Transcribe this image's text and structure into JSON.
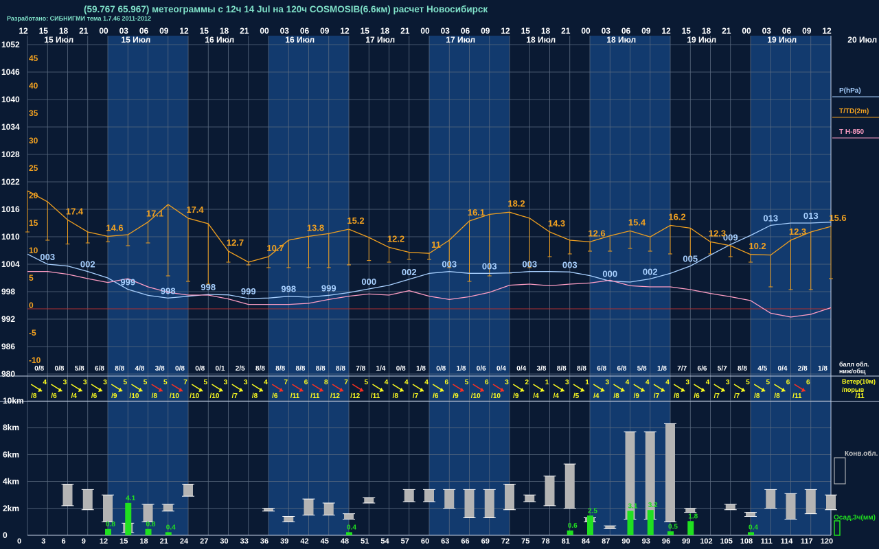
{
  "header": {
    "title": "(59.767 65.967) метеограммы с  12ч 14 Jul на 120ч COSMOSIB(6.6км) расчет Новосибирск",
    "credit": "Разработано: СИБНИГМИ тема 1.7.46 2011-2012"
  },
  "colors": {
    "background": "#0a1a33",
    "band": "#123a6e",
    "grid": "#5a6a80",
    "pressure": "#a8d0ff",
    "temperature": "#f0a020",
    "t850": "#ff9ec4",
    "wind_yellow": "#ffff20",
    "wind_red": "#ff3020",
    "cloud": "#b4b4b4",
    "precip": "#20e020",
    "zero_line": "#b03030"
  },
  "chart_data": [
    {
      "type": "line",
      "name": "meteogram",
      "x_hours": [
        0,
        3,
        6,
        9,
        12,
        15,
        18,
        21,
        24,
        27,
        30,
        33,
        36,
        39,
        42,
        45,
        48,
        51,
        54,
        57,
        60,
        63,
        66,
        69,
        72,
        75,
        78,
        81,
        84,
        87,
        90,
        93,
        96,
        99,
        102,
        105,
        108,
        111,
        114,
        117,
        120
      ],
      "top_hour_labels": [
        "12",
        "15",
        "18",
        "21",
        "00",
        "03",
        "06",
        "09",
        "12",
        "15",
        "18",
        "21",
        "00",
        "03",
        "06",
        "09",
        "12",
        "15",
        "18",
        "21",
        "00",
        "03",
        "06",
        "09",
        "12",
        "15",
        "18",
        "21",
        "00",
        "03",
        "06",
        "09",
        "12",
        "15",
        "18",
        "21",
        "00",
        "03",
        "06",
        "09",
        "12"
      ],
      "day_labels": [
        {
          "hour": 1,
          "text": "15 Июл"
        },
        {
          "hour": 12.5,
          "text": "15 Июл"
        },
        {
          "hour": 25,
          "text": "16 Июл"
        },
        {
          "hour": 37,
          "text": "16 Июл"
        },
        {
          "hour": 49,
          "text": "17 Июл"
        },
        {
          "hour": 61,
          "text": "17 Июл"
        },
        {
          "hour": 73,
          "text": "18 Июл"
        },
        {
          "hour": 85,
          "text": "18 Июл"
        },
        {
          "hour": 97,
          "text": "19 Июл"
        },
        {
          "hour": 109,
          "text": "19 Июл"
        },
        {
          "hour": 121,
          "text": "20 Июл"
        }
      ],
      "pressure_axis": {
        "label": "P(hPa)",
        "ticks": [
          1052,
          1046,
          1040,
          1034,
          1028,
          1022,
          1016,
          1010,
          1004,
          998,
          992,
          986,
          980
        ],
        "ylim": [
          980,
          1054
        ]
      },
      "temperature_axis": {
        "label": "T/TD(2m)",
        "ticks": [
          45,
          40,
          35,
          30,
          25,
          20,
          15,
          10,
          5,
          0,
          -5,
          -10
        ],
        "ylim": [
          -13,
          49
        ]
      },
      "t850_label": "T H-850",
      "pressure": {
        "values": [
          1006.2,
          1004.0,
          1003.6,
          1002.4,
          1001.0,
          998.5,
          997.2,
          996.6,
          997.0,
          997.4,
          997.3,
          996.5,
          996.6,
          997.0,
          996.8,
          997.2,
          997.8,
          998.6,
          999.4,
          1000.7,
          1002.0,
          1002.4,
          1002.0,
          1002.0,
          1002.1,
          1002.4,
          1002.4,
          1002.3,
          1001.5,
          1000.3,
          1000.1,
          1000.8,
          1002.0,
          1003.6,
          1006.0,
          1008.3,
          1010.3,
          1012.5,
          1013.0,
          1013.0,
          1013.2
        ],
        "labels": [
          {
            "i": 1,
            "text": "003"
          },
          {
            "i": 3,
            "text": "002"
          },
          {
            "i": 5,
            "text": "999"
          },
          {
            "i": 7,
            "text": "998"
          },
          {
            "i": 9,
            "text": "998"
          },
          {
            "i": 11,
            "text": "999"
          },
          {
            "i": 13,
            "text": "998"
          },
          {
            "i": 15,
            "text": "999"
          },
          {
            "i": 17,
            "text": "000"
          },
          {
            "i": 19,
            "text": "002"
          },
          {
            "i": 21,
            "text": "003"
          },
          {
            "i": 23,
            "text": "003"
          },
          {
            "i": 25,
            "text": "003"
          },
          {
            "i": 27,
            "text": "003"
          },
          {
            "i": 29,
            "text": "000"
          },
          {
            "i": 31,
            "text": "002"
          },
          {
            "i": 33,
            "text": "005"
          },
          {
            "i": 35,
            "text": "009"
          },
          {
            "i": 37,
            "text": "013"
          },
          {
            "i": 39,
            "text": "013"
          }
        ]
      },
      "temperature": {
        "values": [
          21.5,
          19.5,
          16.2,
          14.0,
          13.2,
          13.5,
          15.8,
          19.0,
          16.5,
          15.5,
          10.5,
          8.5,
          9.5,
          12.5,
          13.2,
          13.7,
          14.5,
          13.0,
          11.2,
          10.3,
          10.1,
          12.5,
          16.0,
          17.2,
          17.6,
          16.5,
          14.0,
          12.5,
          12.2,
          13.3,
          14.2,
          13.1,
          15.2,
          14.7,
          12.2,
          11.5,
          9.9,
          9.8,
          12.5,
          14.0,
          15.0
        ],
        "labels": [
          {
            "i": 2,
            "text": "17.4"
          },
          {
            "i": 4,
            "text": "14.6"
          },
          {
            "i": 6,
            "text": "17.1"
          },
          {
            "i": 8,
            "text": "17.4"
          },
          {
            "i": 10,
            "text": "12.7"
          },
          {
            "i": 12,
            "text": "10.7"
          },
          {
            "i": 14,
            "text": "13.8"
          },
          {
            "i": 16,
            "text": "15.2"
          },
          {
            "i": 18,
            "text": "12.2"
          },
          {
            "i": 20,
            "text": "11"
          },
          {
            "i": 22,
            "text": "16.1"
          },
          {
            "i": 24,
            "text": "18.2"
          },
          {
            "i": 26,
            "text": "14.3"
          },
          {
            "i": 28,
            "text": "12.6"
          },
          {
            "i": 30,
            "text": "15.4"
          },
          {
            "i": 32,
            "text": "16.2"
          },
          {
            "i": 34,
            "text": "12.3"
          },
          {
            "i": 36,
            "text": "10.2"
          },
          {
            "i": 38,
            "text": "12.3"
          },
          {
            "i": 40,
            "text": "15.6"
          }
        ]
      },
      "dewpoint": [
        14.0,
        12.5,
        11.8,
        12.0,
        12.2,
        11.5,
        12.0,
        6.0,
        5.0,
        4.5,
        8.5,
        8.0,
        7.5,
        7.5,
        7.5,
        7.5,
        8.0,
        8.8,
        8.5,
        9.0,
        9.0,
        7.5,
        5.0,
        6.0,
        6.5,
        7.5,
        9.5,
        10.0,
        10.5,
        10.5,
        11.0,
        10.5,
        10.0,
        9.5,
        10.0,
        9.5,
        8.5,
        4.0,
        3.5,
        3.5,
        5.5
      ],
      "t850": [
        6.8,
        6.8,
        6.3,
        5.5,
        4.8,
        5.5,
        4.0,
        3.0,
        2.5,
        2.5,
        1.8,
        0.8,
        0.8,
        0.8,
        1.0,
        1.7,
        2.3,
        2.7,
        2.5,
        3.3,
        2.3,
        1.7,
        2.2,
        3.0,
        4.3,
        4.5,
        4.2,
        4.5,
        4.7,
        5.2,
        4.2,
        4.0,
        4.0,
        3.5,
        2.8,
        2.2,
        1.5,
        -0.8,
        -1.5,
        -1.0,
        0.2
      ],
      "cloud_cover": [
        "0/8",
        "0/8",
        "5/8",
        "6/8",
        "8/8",
        "4/8",
        "3/8",
        "0/8",
        "0/8",
        "0/1",
        "2/5",
        "8/8",
        "8/8",
        "8/8",
        "8/8",
        "8/8",
        "7/8",
        "1/4",
        "0/8",
        "1/8",
        "0/8",
        "1/8",
        "0/6",
        "0/4",
        "0/4",
        "3/8",
        "8/8",
        "8/8",
        "6/8",
        "6/8",
        "5/8",
        "1/8",
        "7/7",
        "6/6",
        "5/7",
        "8/8",
        "4/5",
        "0/4",
        "2/8",
        "1/8"
      ],
      "cloud_cover_label": "балл обл.\nниж/общ",
      "wind": {
        "label": "Ветер(10м)\n/порыв",
        "speed": [
          4,
          3,
          3,
          3,
          5,
          5,
          5,
          7,
          5,
          3,
          3,
          4,
          7,
          6,
          8,
          7,
          5,
          4,
          4,
          4,
          6,
          5,
          6,
          3,
          2,
          1,
          3,
          1,
          3,
          4,
          4,
          4,
          3,
          4,
          3,
          5,
          5,
          6,
          6
        ],
        "gust": [
          8,
          6,
          4,
          6,
          9,
          10,
          8,
          10,
          10,
          10,
          7,
          8,
          6,
          11,
          11,
          12,
          12,
          11,
          8,
          7,
          6,
          9,
          10,
          10,
          9,
          4,
          4,
          5,
          4,
          8,
          9,
          7,
          8,
          6,
          7,
          7,
          8,
          8,
          11,
          11
        ],
        "color": [
          "y",
          "y",
          "y",
          "y",
          "y",
          "y",
          "r",
          "r",
          "y",
          "y",
          "y",
          "y",
          "r",
          "r",
          "r",
          "r",
          "r",
          "y",
          "y",
          "y",
          "y",
          "r",
          "r",
          "r",
          "y",
          "y",
          "y",
          "y",
          "y",
          "y",
          "y",
          "y",
          "y",
          "y",
          "y",
          "y",
          "y",
          "y",
          "r",
          "r"
        ]
      },
      "cloud_axis": {
        "ticks": [
          "10km",
          "8km",
          "6km",
          "4km",
          "2km",
          "0"
        ],
        "ylim_km": [
          0,
          10
        ]
      },
      "convective_label": "Конв.обл.",
      "convective_clouds": [
        {
          "h": 6,
          "base": 2.2,
          "top": 3.8
        },
        {
          "h": 9,
          "base": 1.9,
          "top": 3.4
        },
        {
          "h": 12,
          "base": 1.0,
          "top": 3.0
        },
        {
          "h": 15,
          "base": 0.2,
          "top": 0.9
        },
        {
          "h": 18,
          "base": 1.0,
          "top": 2.3
        },
        {
          "h": 21,
          "base": 1.8,
          "top": 2.3
        },
        {
          "h": 24,
          "base": 2.9,
          "top": 3.8
        },
        {
          "h": 36,
          "base": 1.8,
          "top": 2.0
        },
        {
          "h": 39,
          "base": 1.0,
          "top": 1.4
        },
        {
          "h": 42,
          "base": 1.5,
          "top": 2.7
        },
        {
          "h": 45,
          "base": 1.5,
          "top": 2.4
        },
        {
          "h": 48,
          "base": 1.2,
          "top": 1.6
        },
        {
          "h": 51,
          "base": 2.4,
          "top": 2.8
        },
        {
          "h": 57,
          "base": 2.5,
          "top": 3.4
        },
        {
          "h": 60,
          "base": 2.5,
          "top": 3.4
        },
        {
          "h": 63,
          "base": 2.0,
          "top": 3.4
        },
        {
          "h": 66,
          "base": 1.3,
          "top": 3.4
        },
        {
          "h": 69,
          "base": 1.3,
          "top": 3.4
        },
        {
          "h": 72,
          "base": 1.9,
          "top": 3.8
        },
        {
          "h": 75,
          "base": 2.5,
          "top": 3.0
        },
        {
          "h": 78,
          "base": 2.2,
          "top": 4.4
        },
        {
          "h": 81,
          "base": 2.0,
          "top": 5.3
        },
        {
          "h": 84,
          "base": 1.0,
          "top": 1.3
        },
        {
          "h": 87,
          "base": 0.5,
          "top": 0.7
        },
        {
          "h": 90,
          "base": 1.2,
          "top": 7.7
        },
        {
          "h": 93,
          "base": 1.2,
          "top": 7.7
        },
        {
          "h": 96,
          "base": 1.0,
          "top": 8.3
        },
        {
          "h": 99,
          "base": 1.7,
          "top": 2.0
        },
        {
          "h": 105,
          "base": 1.9,
          "top": 2.3
        },
        {
          "h": 108,
          "base": 1.4,
          "top": 1.7
        },
        {
          "h": 111,
          "base": 2.0,
          "top": 3.4
        },
        {
          "h": 114,
          "base": 1.2,
          "top": 3.1
        },
        {
          "h": 117,
          "base": 1.6,
          "top": 3.4
        },
        {
          "h": 120,
          "base": 1.9,
          "top": 3.0
        }
      ],
      "precip_label": "Осад,3ч(мм)",
      "precipitation": [
        {
          "h": 12,
          "mm": 0.8,
          "label": "0.8"
        },
        {
          "h": 15,
          "mm": 4.1,
          "label": "4.1"
        },
        {
          "h": 18,
          "mm": 0.8,
          "label": "0.8"
        },
        {
          "h": 21,
          "mm": 0.4,
          "label": "0.4"
        },
        {
          "h": 48,
          "mm": 0.4,
          "label": "0.4"
        },
        {
          "h": 81,
          "mm": 0.6,
          "label": "0.6"
        },
        {
          "h": 84,
          "mm": 2.5,
          "label": "2.5"
        },
        {
          "h": 90,
          "mm": 3.1,
          "label": "3.1"
        },
        {
          "h": 93,
          "mm": 3.2,
          "label": "3.2"
        },
        {
          "h": 96,
          "mm": 0.5,
          "label": "0.5"
        },
        {
          "h": 99,
          "mm": 1.8,
          "label": "1.8"
        },
        {
          "h": 108,
          "mm": 0.4,
          "label": "0.4"
        }
      ],
      "bottom_hour_labels": [
        "0",
        "3",
        "6",
        "9",
        "12",
        "15",
        "18",
        "21",
        "24",
        "27",
        "30",
        "33",
        "36",
        "39",
        "42",
        "45",
        "48",
        "51",
        "54",
        "57",
        "60",
        "63",
        "66",
        "69",
        "72",
        "75",
        "78",
        "81",
        "84",
        "87",
        "90",
        "93",
        "96",
        "99",
        "102",
        "105",
        "108",
        "111",
        "114",
        "117",
        "120"
      ]
    }
  ]
}
